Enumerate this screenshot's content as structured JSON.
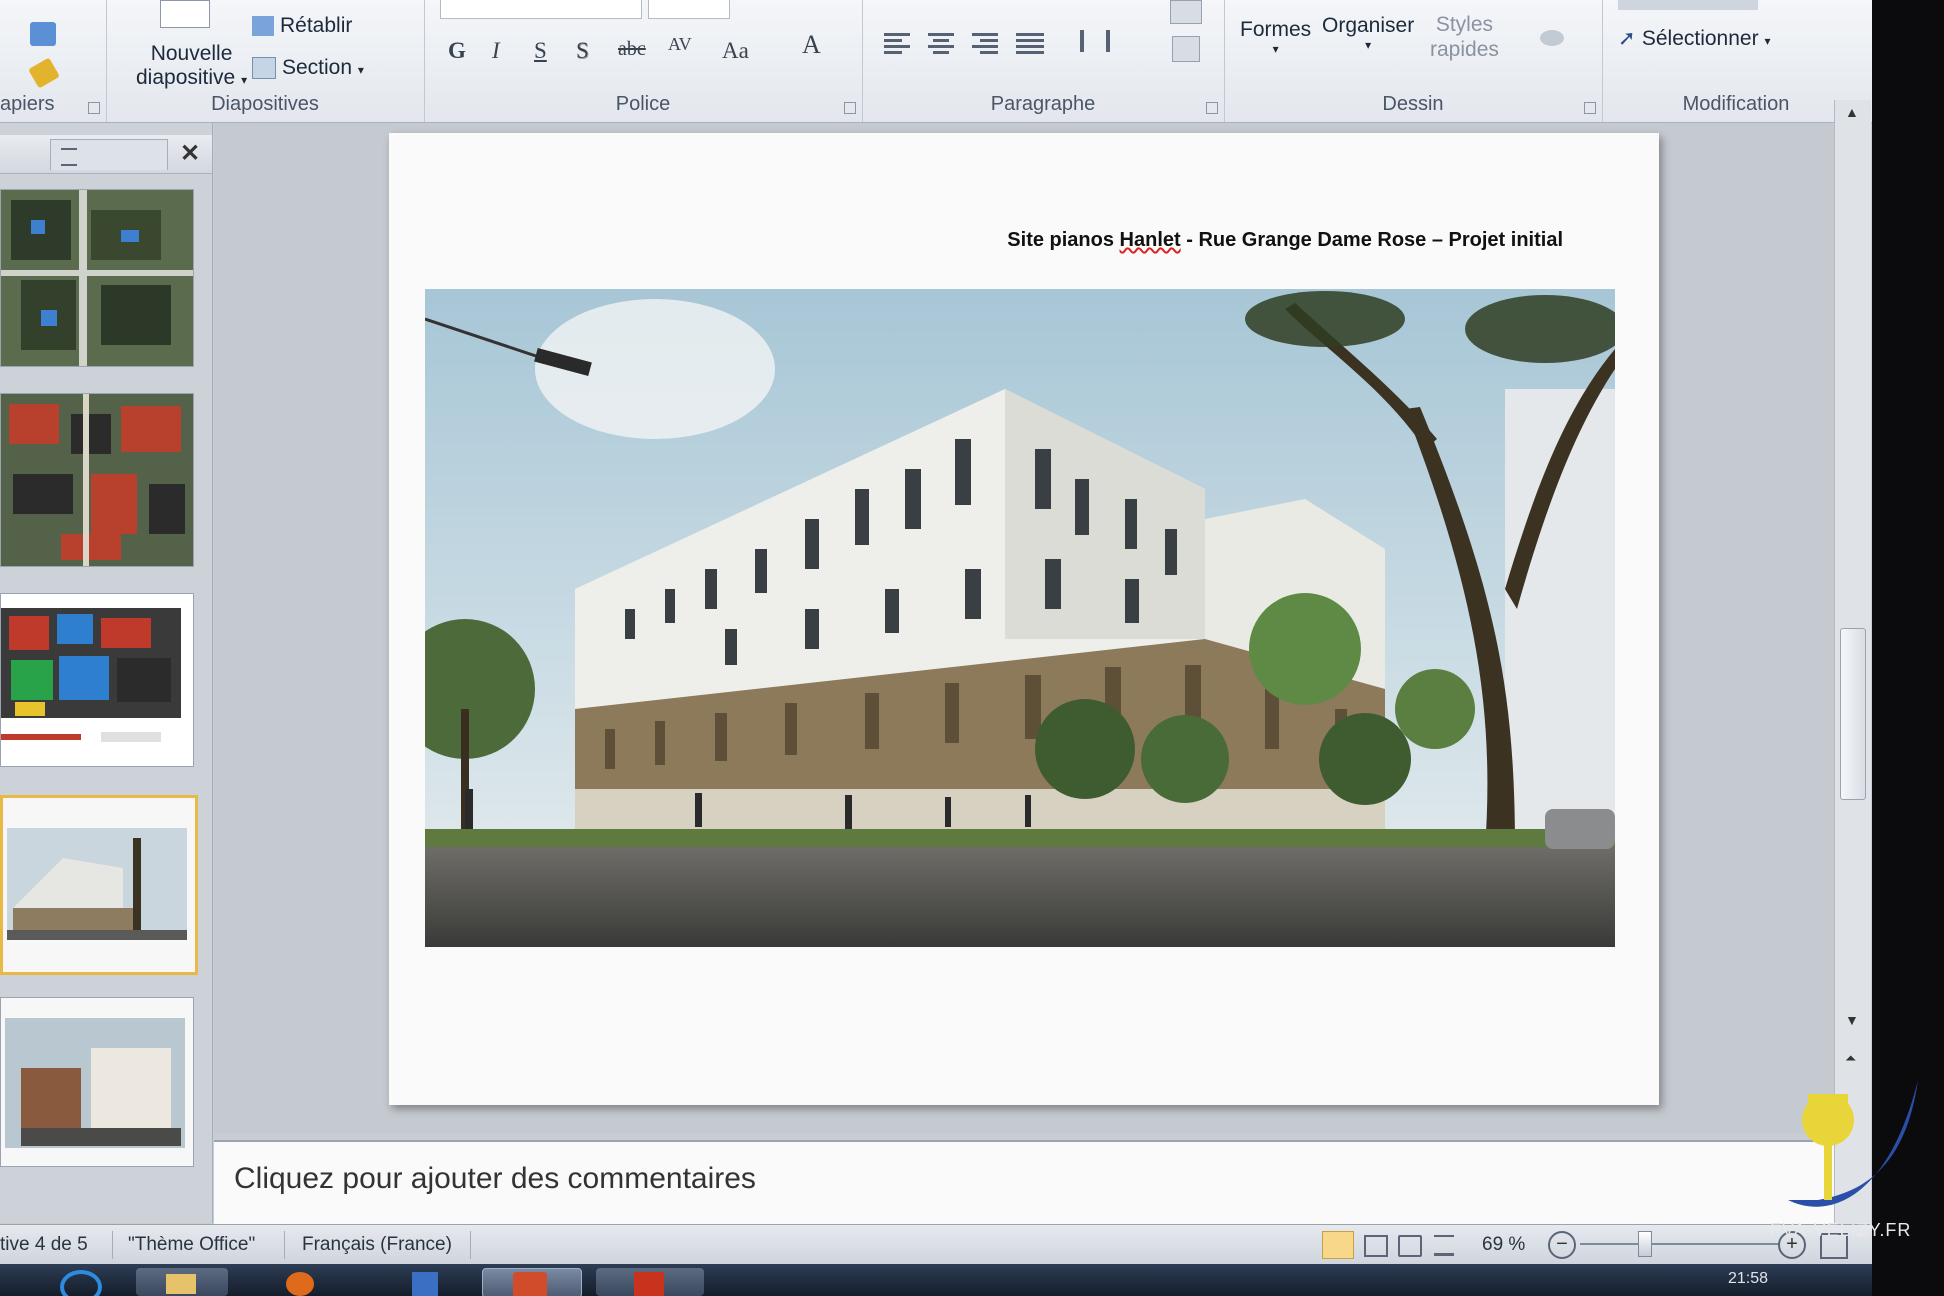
{
  "ribbon": {
    "clipboard": {
      "group_label": "apiers"
    },
    "slides": {
      "new_slide_label_1": "Nouvelle",
      "new_slide_label_2": "diapositive",
      "reset_label": "Rétablir",
      "section_label": "Section",
      "group_label": "Diapositives"
    },
    "font": {
      "bold": "G",
      "italic": "I",
      "underline": "S",
      "shadow": "S",
      "strike": "abc",
      "spacing": "AV",
      "case": "Aa",
      "color": "A",
      "group_label": "Police"
    },
    "paragraph": {
      "group_label": "Paragraphe"
    },
    "drawing": {
      "shapes_label": "Formes",
      "arrange_label": "Organiser",
      "quick_styles_label_1": "Styles",
      "quick_styles_label_2": "rapides",
      "group_label": "Dessin"
    },
    "editing": {
      "select_label": "Sélectionner",
      "group_label": "Modification"
    }
  },
  "slide": {
    "title_part1": "Site pianos ",
    "title_part2": "Hanlet",
    "title_part3": " -  Rue Grange Dame Rose – Projet initial"
  },
  "notes": {
    "placeholder": "Cliquez pour ajouter des commentaires"
  },
  "status_bar": {
    "slide_indicator": "tive 4 de 5",
    "theme": "\"Thème Office\"",
    "language": "Français (France)",
    "zoom": "69 %"
  },
  "taskbar": {
    "clock": "21:58"
  },
  "watermark": {
    "text": "FVA-VELIZY.FR"
  },
  "colors": {
    "ribbon_bg": "#e9ecf1",
    "active_thumb_border": "#e8b946",
    "spell_error": "#d22222"
  }
}
